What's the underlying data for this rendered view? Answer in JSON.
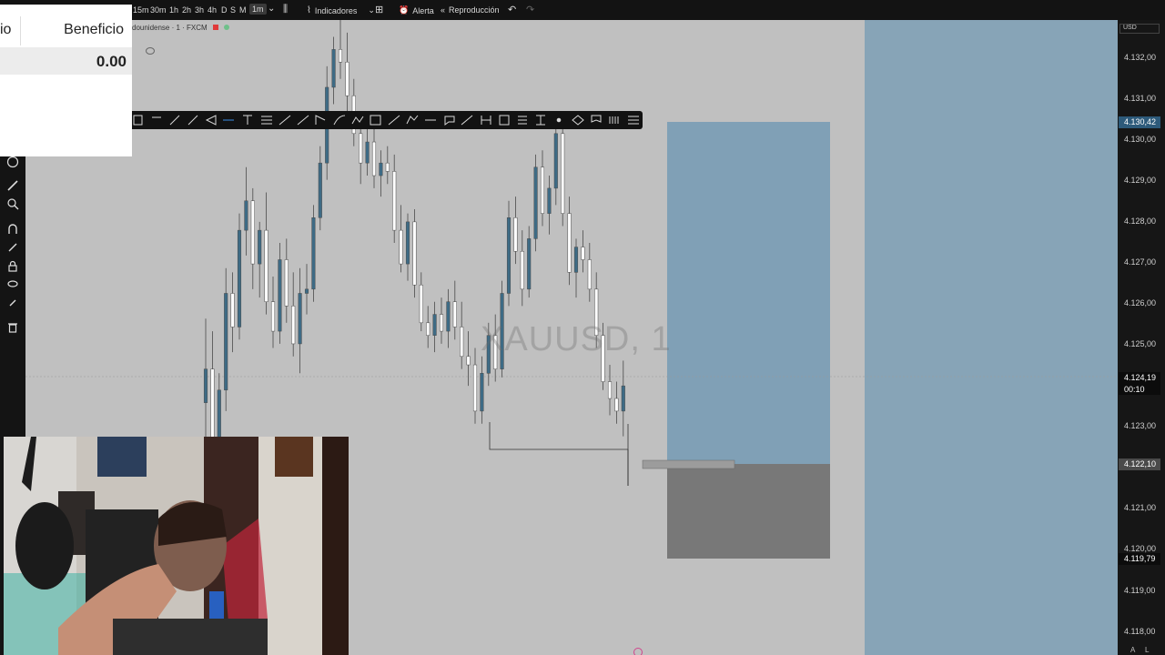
{
  "topbar": {
    "timeframes": [
      "15m",
      "30m",
      "1h",
      "2h",
      "3h",
      "4h",
      "D",
      "S",
      "M",
      "1m"
    ],
    "active_timeframe": "1m",
    "indicators_label": "Indicadores",
    "alert_label": "Alerta",
    "replay_label": "Reproducción"
  },
  "symbol_legend": {
    "text": "dounidense · 1 · FXCM"
  },
  "watermark": "XAUUSD, 1",
  "side_panel": {
    "col_left": "io",
    "col_right": "Beneficio",
    "value": "0.00"
  },
  "price_axis": {
    "currency": "USD",
    "labels": [
      "4.132,00",
      "4.131,00",
      "4.130,00",
      "4.129,00",
      "4.128,00",
      "4.127,00",
      "4.126,00",
      "4.125,00",
      "4.123,00",
      "4.121,00",
      "4.120,00",
      "4.119,00",
      "4.118,00"
    ],
    "tags": {
      "target": "4.130,42",
      "current": "4.124,19",
      "countdown": "00:10",
      "entry": "4.122,10",
      "stop": "4.119,79"
    },
    "bottom_letters": [
      "A",
      "L"
    ]
  },
  "colors": {
    "profit_zone": "#7d9fb5",
    "loss_zone": "#7a7a7a",
    "candle_up": "#3e6b85",
    "candle_down": "#ffffff",
    "axis_highlight": "#2d5a7a"
  },
  "chart_data": {
    "type": "candlestick",
    "title": "XAUUSD, 1",
    "ylim": [
      4117.5,
      4132.6
    ],
    "candles": [
      [
        4123.5,
        4125.5,
        4121.3,
        4124.3
      ],
      [
        4124.3,
        4125.2,
        4121.8,
        4122.2
      ],
      [
        4122.2,
        4124.2,
        4121.0,
        4123.8
      ],
      [
        4123.8,
        4126.7,
        4123.3,
        4126.1
      ],
      [
        4126.1,
        4126.6,
        4124.7,
        4125.3
      ],
      [
        4125.3,
        4128.0,
        4125.0,
        4127.6
      ],
      [
        4127.6,
        4129.1,
        4127.0,
        4128.3
      ],
      [
        4128.3,
        4128.6,
        4126.2,
        4126.8
      ],
      [
        4126.8,
        4127.8,
        4126.0,
        4127.6
      ],
      [
        4127.6,
        4128.5,
        4125.6,
        4125.9
      ],
      [
        4125.9,
        4126.5,
        4124.8,
        4125.2
      ],
      [
        4125.2,
        4127.3,
        4124.9,
        4126.9
      ],
      [
        4126.9,
        4127.4,
        4125.4,
        4125.8
      ],
      [
        4125.8,
        4126.6,
        4124.6,
        4124.9
      ],
      [
        4124.9,
        4126.7,
        4124.2,
        4126.1
      ],
      [
        4126.1,
        4126.8,
        4125.6,
        4126.2
      ],
      [
        4126.2,
        4128.2,
        4125.9,
        4127.9
      ],
      [
        4127.9,
        4129.6,
        4127.6,
        4129.2
      ],
      [
        4129.2,
        4131.5,
        4128.8,
        4131.0
      ],
      [
        4131.0,
        4132.2,
        4130.6,
        4131.9
      ],
      [
        4131.9,
        4132.6,
        4131.2,
        4131.6
      ],
      [
        4131.6,
        4132.3,
        4130.4,
        4130.8
      ],
      [
        4130.8,
        4131.2,
        4129.6,
        4129.9
      ],
      [
        4129.9,
        4130.4,
        4128.7,
        4129.2
      ],
      [
        4129.2,
        4130.1,
        4128.9,
        4129.7
      ],
      [
        4129.7,
        4130.2,
        4128.6,
        4128.9
      ],
      [
        4128.9,
        4129.5,
        4128.4,
        4129.2
      ],
      [
        4129.2,
        4129.6,
        4128.7,
        4129.0
      ],
      [
        4129.0,
        4129.4,
        4127.3,
        4127.6
      ],
      [
        4127.6,
        4128.2,
        4126.6,
        4126.8
      ],
      [
        4126.8,
        4128.0,
        4126.4,
        4127.8
      ],
      [
        4127.8,
        4128.1,
        4126.0,
        4126.3
      ],
      [
        4126.3,
        4126.6,
        4125.2,
        4125.4
      ],
      [
        4125.4,
        4125.8,
        4124.8,
        4125.1
      ],
      [
        4125.1,
        4125.9,
        4124.7,
        4125.6
      ],
      [
        4125.6,
        4126.0,
        4124.9,
        4125.2
      ],
      [
        4125.2,
        4126.2,
        4124.8,
        4125.9
      ],
      [
        4125.9,
        4126.4,
        4125.0,
        4125.3
      ],
      [
        4125.3,
        4125.9,
        4124.3,
        4124.6
      ],
      [
        4124.6,
        4125.2,
        4123.9,
        4124.4
      ],
      [
        4124.4,
        4124.8,
        4123.0,
        4123.3
      ],
      [
        4123.3,
        4124.6,
        4123.0,
        4124.2
      ],
      [
        4124.2,
        4125.4,
        4123.9,
        4125.1
      ],
      [
        4125.1,
        4125.6,
        4124.0,
        4124.3
      ],
      [
        4124.3,
        4126.4,
        4124.1,
        4126.1
      ],
      [
        4126.1,
        4128.3,
        4125.8,
        4127.9
      ],
      [
        4127.9,
        4128.4,
        4126.8,
        4127.1
      ],
      [
        4127.1,
        4127.6,
        4125.8,
        4126.2
      ],
      [
        4126.2,
        4127.7,
        4126.0,
        4127.4
      ],
      [
        4127.4,
        4129.4,
        4127.1,
        4129.1
      ],
      [
        4129.1,
        4129.5,
        4127.7,
        4128.0
      ],
      [
        4128.0,
        4128.9,
        4127.5,
        4128.6
      ],
      [
        4128.6,
        4130.2,
        4128.2,
        4129.9
      ],
      [
        4129.9,
        4130.3,
        4127.7,
        4128.0
      ],
      [
        4128.0,
        4128.4,
        4126.3,
        4126.6
      ],
      [
        4126.6,
        4127.4,
        4126.0,
        4127.2
      ],
      [
        4127.2,
        4127.6,
        4126.6,
        4126.9
      ],
      [
        4126.9,
        4127.3,
        4125.9,
        4126.2
      ],
      [
        4126.2,
        4126.6,
        4124.8,
        4125.1
      ],
      [
        4125.1,
        4125.4,
        4123.8,
        4124.0
      ],
      [
        4124.0,
        4124.4,
        4123.2,
        4123.6
      ],
      [
        4123.6,
        4124.0,
        4123.0,
        4123.3
      ],
      [
        4123.3,
        4124.5,
        4122.7,
        4123.9
      ]
    ]
  }
}
